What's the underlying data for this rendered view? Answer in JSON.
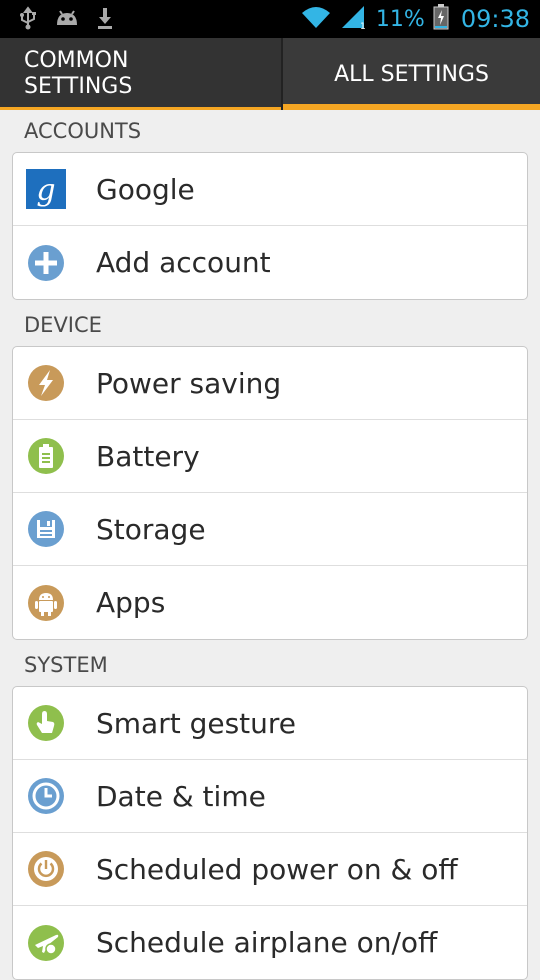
{
  "status_bar": {
    "battery_percent": "11%",
    "time": "09:38",
    "icons": [
      "usb-icon",
      "android-debug-icon",
      "download-icon",
      "wifi-icon",
      "signal-icon",
      "battery-charging-icon"
    ]
  },
  "tabs": [
    {
      "label": "COMMON SETTINGS",
      "line1": "COMMON",
      "line2": "SETTINGS",
      "selected": false
    },
    {
      "label": "ALL SETTINGS",
      "selected": true
    }
  ],
  "accent_color": "#f5a623",
  "sections": {
    "accounts": {
      "header": "ACCOUNTS",
      "items": [
        {
          "label": "Google",
          "icon": "google-icon"
        },
        {
          "label": "Add account",
          "icon": "add-circle-icon"
        }
      ]
    },
    "device": {
      "header": "DEVICE",
      "items": [
        {
          "label": "Power saving",
          "icon": "lightning-icon"
        },
        {
          "label": "Battery",
          "icon": "battery-icon"
        },
        {
          "label": "Storage",
          "icon": "storage-icon"
        },
        {
          "label": "Apps",
          "icon": "android-icon"
        }
      ]
    },
    "system": {
      "header": "SYSTEM",
      "items": [
        {
          "label": "Smart gesture",
          "icon": "hand-gesture-icon"
        },
        {
          "label": "Date & time",
          "icon": "clock-icon"
        },
        {
          "label": "Scheduled power on & off",
          "icon": "power-icon"
        },
        {
          "label": "Schedule airplane on/off",
          "icon": "airplane-icon"
        }
      ]
    }
  }
}
